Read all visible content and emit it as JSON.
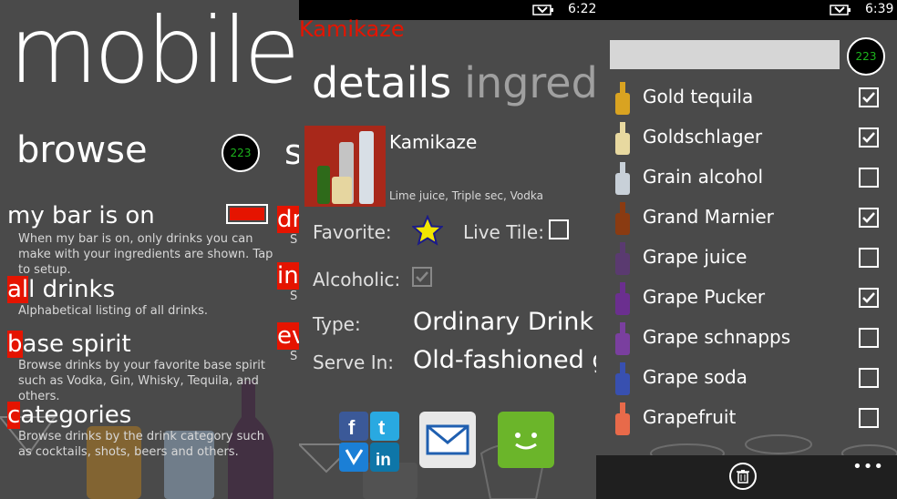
{
  "panel1": {
    "title": "mobile",
    "section_title": "browse",
    "count_badge": "223",
    "next_section_fragment": "s",
    "bar_toggle_on": true,
    "items": [
      {
        "highlight": "",
        "rest": "my bar is on",
        "desc": "When my bar is on, only drinks you can make with your ingredients are shown. Tap to setup."
      },
      {
        "highlight": "al",
        "rest": "l drinks",
        "desc": "Alphabetical listing of all drinks."
      },
      {
        "highlight": "b",
        "rest": "ase spirit",
        "desc": "Browse drinks by your favorite base spirit such as Vodka, Gin, Whisky, Tequila, and others."
      },
      {
        "highlight": "c",
        "rest": "ategories",
        "desc": "Browse drinks by the drink category such as cocktails, shots, beers and others."
      }
    ],
    "side_fragments": [
      {
        "text": "dr",
        "sub": "S"
      },
      {
        "text": "in",
        "sub": "S"
      },
      {
        "text": "ev",
        "sub": "S"
      }
    ]
  },
  "panel2": {
    "status_time": "6:22",
    "drink_header": "Kamikaze",
    "tab_details": "details",
    "tab_ingredients": "ingredie",
    "drink_title": "Kamikaze",
    "ingredients_line": "Lime juice, Triple sec, Vodka",
    "favorite_label": "Favorite:",
    "live_tile_label": "Live Tile:",
    "alcoholic_label": "Alcoholic:",
    "type_label": "Type:",
    "type_value": "Ordinary Drink",
    "serve_label": "Serve In:",
    "serve_value": "Old-fashioned g",
    "colors": {
      "accent": "#e51400",
      "star": "#f2e600"
    }
  },
  "panel3": {
    "status_time": "6:39",
    "count_badge": "223",
    "search_value": "",
    "ingredients": [
      {
        "name": "Gold tequila",
        "checked": true,
        "bottle_color": "#d9a321"
      },
      {
        "name": "Goldschlager",
        "checked": true,
        "bottle_color": "#e8d9a0"
      },
      {
        "name": "Grain alcohol",
        "checked": false,
        "bottle_color": "#c8d0d8"
      },
      {
        "name": "Grand Marnier",
        "checked": true,
        "bottle_color": "#8a3b12"
      },
      {
        "name": "Grape juice",
        "checked": false,
        "bottle_color": "#5a3a70"
      },
      {
        "name": "Grape Pucker",
        "checked": true,
        "bottle_color": "#6b2f8f"
      },
      {
        "name": "Grape schnapps",
        "checked": false,
        "bottle_color": "#7a3f9f"
      },
      {
        "name": "Grape soda",
        "checked": false,
        "bottle_color": "#3850b0"
      },
      {
        "name": "Grapefruit",
        "checked": false,
        "bottle_color": "#e86a4a"
      }
    ],
    "appbar_more": "•••"
  }
}
